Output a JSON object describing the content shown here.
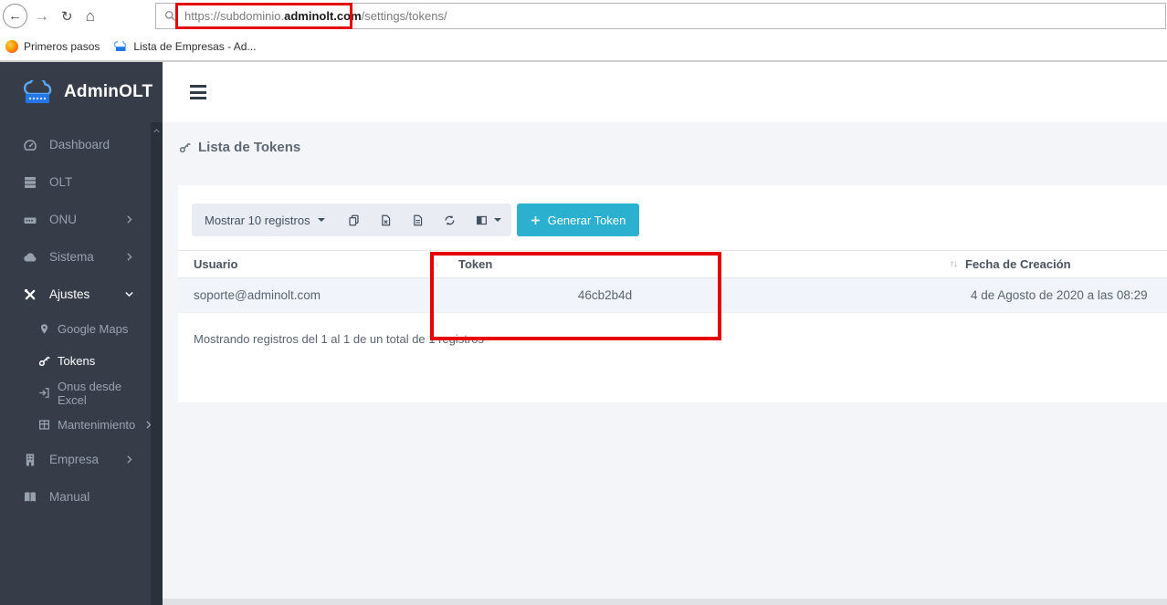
{
  "browser": {
    "url_pre": "https://subdominio.",
    "url_bold": "adminolt.com",
    "url_post": "/settings/tokens/",
    "bookmarks": [
      {
        "label": "Primeros pasos"
      },
      {
        "label": "Lista de Empresas - Ad..."
      }
    ]
  },
  "glyphs": {
    "back": "←",
    "forward": "→",
    "reload": "↻",
    "home": "⌂",
    "sort": "↑↓"
  },
  "sidebar": {
    "logo_text": "AdminOLT",
    "items": [
      {
        "label": "Dashboard"
      },
      {
        "label": "OLT"
      },
      {
        "label": "ONU"
      },
      {
        "label": "Sistema"
      },
      {
        "label": "Ajustes"
      },
      {
        "label": "Google Maps"
      },
      {
        "label": "Tokens"
      },
      {
        "label": "Onus desde Excel"
      },
      {
        "label": "Mantenimiento"
      },
      {
        "label": "Empresa"
      },
      {
        "label": "Manual"
      }
    ]
  },
  "page": {
    "title": "Lista de Tokens"
  },
  "toolbar": {
    "length_label": "Mostrar 10 registros",
    "generate_label": "Generar Token"
  },
  "table": {
    "headers": {
      "usuario": "Usuario",
      "token": "Token",
      "fecha": "Fecha de Creación"
    },
    "rows": [
      {
        "usuario": "soporte@adminolt.com",
        "token": "46cb2b4d",
        "fecha": "4 de Agosto de 2020 a las 08:29"
      }
    ],
    "info": "Mostrando registros del 1 al 1 de un total de 1 registros"
  },
  "colors": {
    "accent": "#2bb0cf",
    "annotation": "#e60000",
    "sidebar_bg": "#363d49",
    "logo_blue": "#2276e8"
  }
}
